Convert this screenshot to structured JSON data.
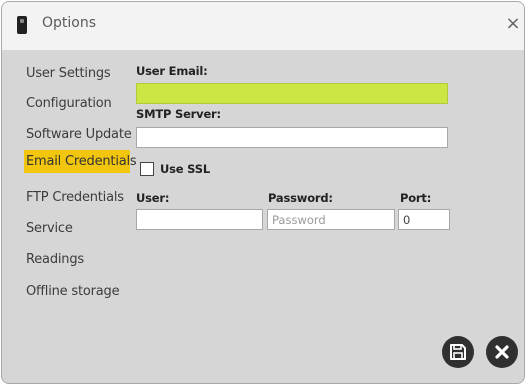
{
  "window": {
    "title": "Options",
    "close_glyph": "×"
  },
  "sidebar": {
    "items": [
      {
        "label": "User Settings"
      },
      {
        "label": "Configuration"
      },
      {
        "label": "Software Update"
      },
      {
        "label": "Email Credentials",
        "active": true
      },
      {
        "label": "FTP Credentials"
      },
      {
        "label": "Service"
      },
      {
        "label": "Readings"
      },
      {
        "label": "Offline storage"
      }
    ],
    "active_color": "#f2c60d"
  },
  "form": {
    "user_email": {
      "label": "User Email:",
      "value": "",
      "highlight_color": "#cce643"
    },
    "smtp_server": {
      "label": "SMTP Server:",
      "value": ""
    },
    "use_ssl": {
      "label": "Use SSL",
      "checked": false
    },
    "user": {
      "label": "User:",
      "value": ""
    },
    "password": {
      "label": "Password:",
      "value": "",
      "placeholder": "Password"
    },
    "port": {
      "label": "Port:",
      "value": "0"
    }
  },
  "actions": {
    "save_icon": "save-icon",
    "close_icon": "close-icon"
  }
}
